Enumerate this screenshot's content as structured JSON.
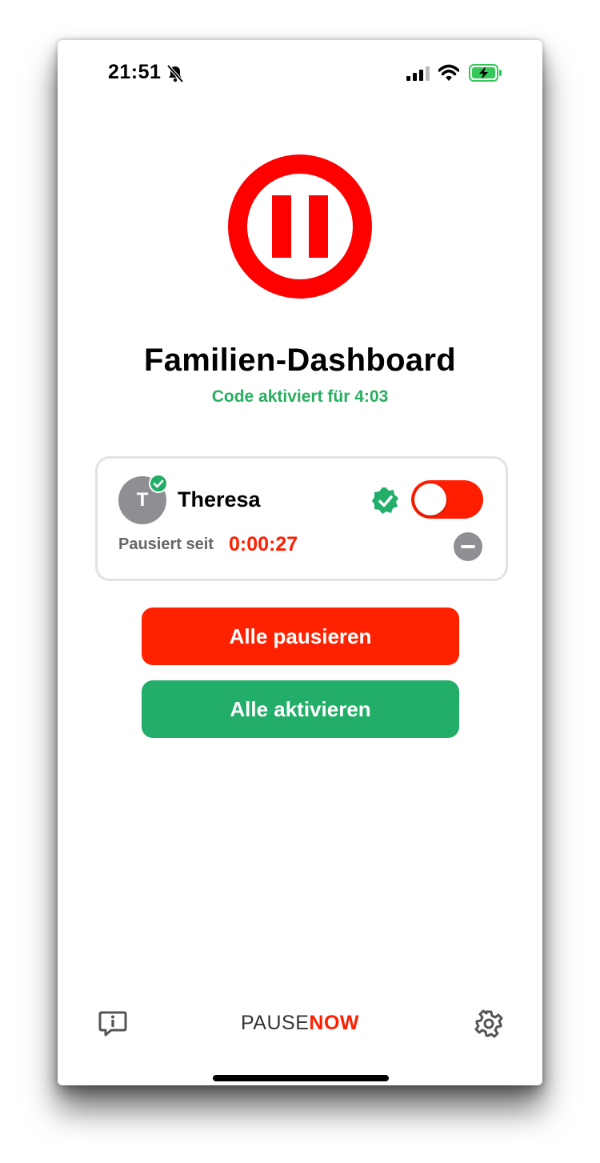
{
  "status_bar": {
    "time": "21:51",
    "icons": [
      "bell-slash-icon",
      "signal-icon",
      "wifi-icon",
      "battery-charging-icon"
    ]
  },
  "header": {
    "logo": "pause-icon",
    "title": "Familien-Dashboard",
    "code_status": "Code aktiviert für 4:03"
  },
  "members": [
    {
      "initial": "T",
      "name": "Theresa",
      "verified": true,
      "toggle_on": false,
      "paused_label": "Pausiert seit",
      "paused_timer": "0:00:27"
    }
  ],
  "actions": {
    "pause_all": "Alle pausieren",
    "activate_all": "Alle aktivieren"
  },
  "footer": {
    "brand_part1": "PAUSE",
    "brand_part2": "NOW",
    "left_icon": "info-bubble-icon",
    "right_icon": "gear-icon"
  },
  "colors": {
    "accent_red": "#ff1e00",
    "accent_green": "#22ae68",
    "code_green": "#27ae60"
  }
}
